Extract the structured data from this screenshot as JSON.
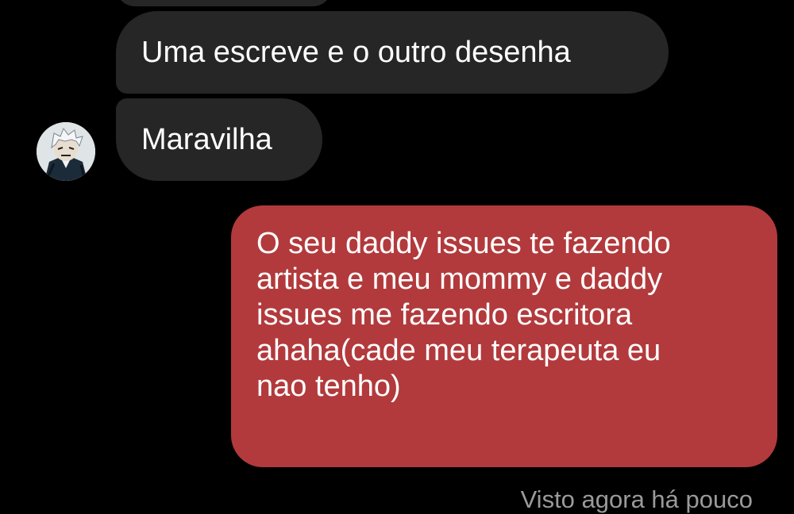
{
  "chat": {
    "avatar_icon": "user-avatar-icon",
    "incoming": [
      {
        "text": "Uma escreve e o outro desenha"
      },
      {
        "text": "Maravilha"
      }
    ],
    "outgoing": {
      "lines": [
        "O seu daddy issues te fazendo",
        "artista e meu mommy e daddy",
        "issues me fazendo escritora",
        "ahaha(cade meu terapeuta eu",
        "nao tenho)"
      ]
    },
    "seen_status": "Visto agora há pouco"
  },
  "colors": {
    "background": "#000000",
    "incoming_bubble": "#262626",
    "outgoing_bubble": "#b23a3c",
    "seen_text": "#9a9a9a"
  }
}
